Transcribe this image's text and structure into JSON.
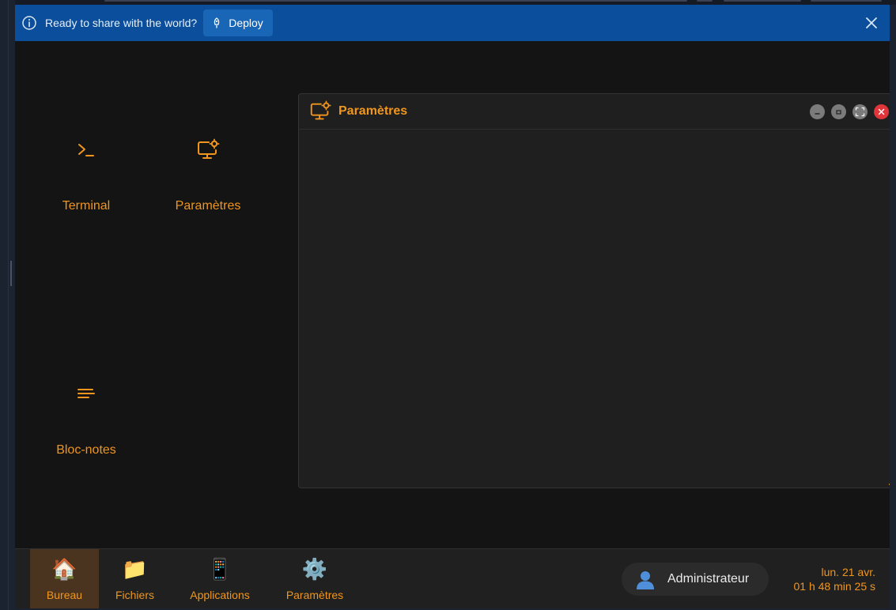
{
  "banner": {
    "message": "Ready to share with the world?",
    "deploy_label": "Deploy",
    "bg_color": "#0b4f9c"
  },
  "desktop": {
    "icons": [
      {
        "label": "Terminal",
        "icon": "terminal-prompt-icon"
      },
      {
        "label": "Paramètres",
        "icon": "monitor-gear-icon"
      },
      {
        "label": "Bloc-notes",
        "icon": "text-lines-icon"
      }
    ]
  },
  "window": {
    "title": "Paramètres",
    "icon": "monitor-gear-icon",
    "controls": [
      "minimize",
      "restore",
      "maximize",
      "close"
    ]
  },
  "taskbar": {
    "items": [
      {
        "label": "Bureau",
        "emoji": "🏠",
        "active": true
      },
      {
        "label": "Fichiers",
        "emoji": "📁",
        "active": false
      },
      {
        "label": "Applications",
        "emoji": "📱",
        "active": false
      },
      {
        "label": "Paramètres",
        "emoji": "⚙️",
        "active": false
      }
    ],
    "user": {
      "name": "Administrateur",
      "icon": "user-silhouette-icon"
    },
    "clock": {
      "date": "lun. 21 avr.",
      "time": "01 h 48 min 25 s"
    }
  },
  "colors": {
    "accent": "#f0961e",
    "close_red": "#e0353b"
  }
}
